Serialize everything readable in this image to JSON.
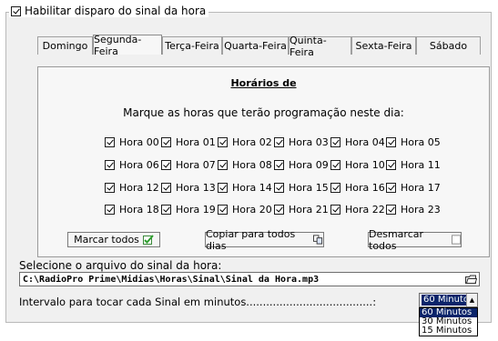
{
  "enable": {
    "label": "Habilitar disparo do sinal da hora",
    "checked": true
  },
  "tabs": [
    {
      "label": "Domingo",
      "active": false
    },
    {
      "label": "Segunda-Feira",
      "active": true
    },
    {
      "label": "Terça-Feira",
      "active": false
    },
    {
      "label": "Quarta-Feira",
      "active": false
    },
    {
      "label": "Quinta-Feira",
      "active": false
    },
    {
      "label": "Sexta-Feira",
      "active": false
    },
    {
      "label": "Sábado",
      "active": false
    }
  ],
  "panel": {
    "title": "Horários de",
    "instruction": "Marque as horas que terão programação neste dia:",
    "hours": [
      "Hora 00",
      "Hora 01",
      "Hora 02",
      "Hora 03",
      "Hora 04",
      "Hora 05",
      "Hora 06",
      "Hora 07",
      "Hora 08",
      "Hora 09",
      "Hora 10",
      "Hora 11",
      "Hora 12",
      "Hora 13",
      "Hora 14",
      "Hora 15",
      "Hora 16",
      "Hora 17",
      "Hora 18",
      "Hora 19",
      "Hora 20",
      "Hora 21",
      "Hora 22",
      "Hora 23"
    ],
    "all_checked": true,
    "buttons": {
      "mark_all": "Marcar todos",
      "copy_all": "Copiar para todos dias",
      "unmark_all": "Desmarcar todos"
    }
  },
  "file": {
    "label": "Selecione o arquivo do sinal da hora:",
    "path": "C:\\RadioPro Prime\\Midias\\Horas\\Sinal\\Sinal da Hora.mp3"
  },
  "interval": {
    "label": "Intervalo para tocar cada Sinal em minutos......................................:",
    "selected": "60 Minutos",
    "options": [
      "60 Minutos",
      "30 Minutos",
      "15 Minutos"
    ]
  },
  "colors": {
    "selection": "#0a246a",
    "panel_bg": "#f7f7f7",
    "window_bg": "#f0f0f0"
  }
}
